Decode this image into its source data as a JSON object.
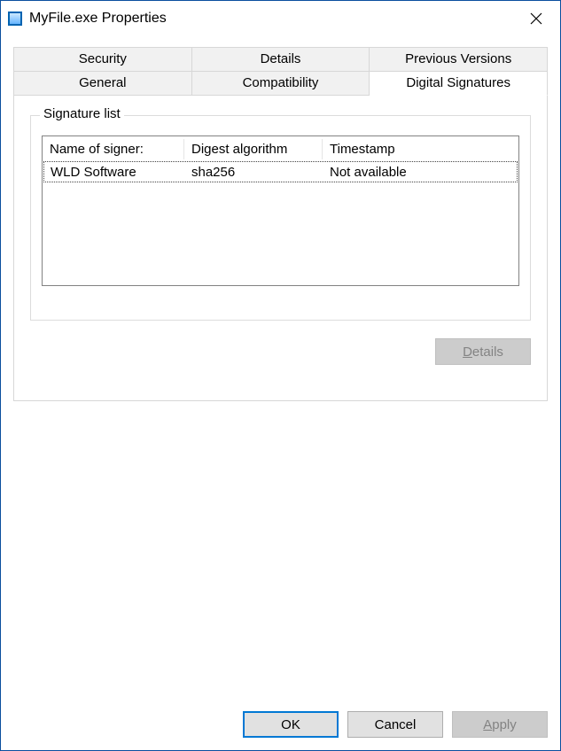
{
  "window": {
    "title": "MyFile.exe Properties"
  },
  "tabs": {
    "row1": [
      "Security",
      "Details",
      "Previous Versions"
    ],
    "row2": [
      "General",
      "Compatibility",
      "Digital Signatures"
    ],
    "active": "Digital Signatures"
  },
  "signature_group": {
    "legend": "Signature list",
    "columns": [
      "Name of signer:",
      "Digest algorithm",
      "Timestamp"
    ],
    "rows": [
      {
        "signer": "WLD Software",
        "digest": "sha256",
        "timestamp": "Not available"
      }
    ],
    "details_button": "Details"
  },
  "footer": {
    "ok": "OK",
    "cancel": "Cancel",
    "apply": "Apply"
  }
}
